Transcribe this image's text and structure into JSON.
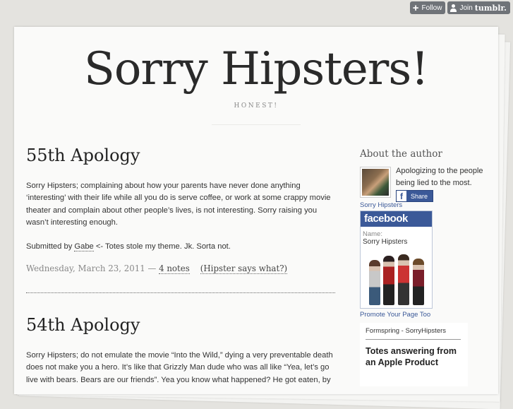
{
  "tumblr_controls": {
    "follow_label": "Follow",
    "join_label": "Join",
    "brand": "tumblr."
  },
  "blog": {
    "title": "Sorry Hipsters!",
    "subtitle": "HONEST!"
  },
  "posts": [
    {
      "title": "55th Apology",
      "paragraph1": "Sorry Hipsters; complaining about how your parents have never done anything ‘interesting’ with their life while all you do is serve coffee, or work at some crappy movie theater and complain about other people’s lives, is not interesting. Sorry raising you wasn’t interesting enough.",
      "submitted_prefix": "Submitted by ",
      "submitted_by": "Gabe",
      "submitted_suffix": " <- Totes stole my theme. Jk. Sorta not.",
      "date": "Wednesday, March 23, 2011",
      "separator": " — ",
      "notes": "4 notes",
      "comment_link": "(Hipster says what?)"
    },
    {
      "title": "54th Apology",
      "paragraph1": "Sorry Hipsters; do not emulate the movie “Into the Wild,” dying a very preventable death does not make you a hero. It’s like that Grizzly Man dude who was all like “Yea, let’s go live with bears. Bears are our friends”. Yea you know what happened? He got eaten, by"
    }
  ],
  "sidebar": {
    "heading": "About the author",
    "author_description": "Apologizing to the people being lied to the most.",
    "share_label": "Share",
    "fb_badge_link": "Sorry Hipsters",
    "fb_brand": "facebook",
    "fb_name_label": "Name:",
    "fb_name": "Sorry Hipsters",
    "promote_link": "Promote Your Page Too",
    "formspring_title": "Formspring - SorryHipsters",
    "formspring_question": "Totes answering from an Apple Product"
  }
}
